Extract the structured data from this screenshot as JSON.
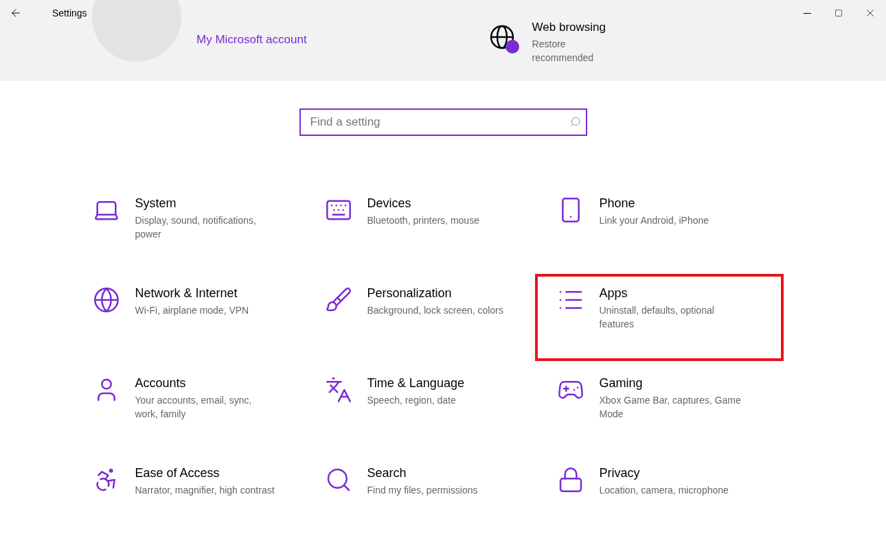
{
  "window": {
    "title": "Settings"
  },
  "banner": {
    "account_link": "My Microsoft account",
    "backup_title": "Web browsing",
    "backup_subtitle": "Restore recommended"
  },
  "search": {
    "placeholder": "Find a setting"
  },
  "categories": [
    {
      "title": "System",
      "description": "Display, sound, notifications, power",
      "highlighted": false
    },
    {
      "title": "Devices",
      "description": "Bluetooth, printers, mouse",
      "highlighted": false
    },
    {
      "title": "Phone",
      "description": "Link your Android, iPhone",
      "highlighted": false
    },
    {
      "title": "Network & Internet",
      "description": "Wi-Fi, airplane mode, VPN",
      "highlighted": false
    },
    {
      "title": "Personalization",
      "description": "Background, lock screen, colors",
      "highlighted": false
    },
    {
      "title": "Apps",
      "description": "Uninstall, defaults, optional features",
      "highlighted": true
    },
    {
      "title": "Accounts",
      "description": "Your accounts, email, sync, work, family",
      "highlighted": false
    },
    {
      "title": "Time & Language",
      "description": "Speech, region, date",
      "highlighted": false
    },
    {
      "title": "Gaming",
      "description": "Xbox Game Bar, captures, Game Mode",
      "highlighted": false
    },
    {
      "title": "Ease of Access",
      "description": "Narrator, magnifier, high contrast",
      "highlighted": false
    },
    {
      "title": "Search",
      "description": "Find my files, permissions",
      "highlighted": false
    },
    {
      "title": "Privacy",
      "description": "Location, camera, microphone",
      "highlighted": false
    }
  ]
}
